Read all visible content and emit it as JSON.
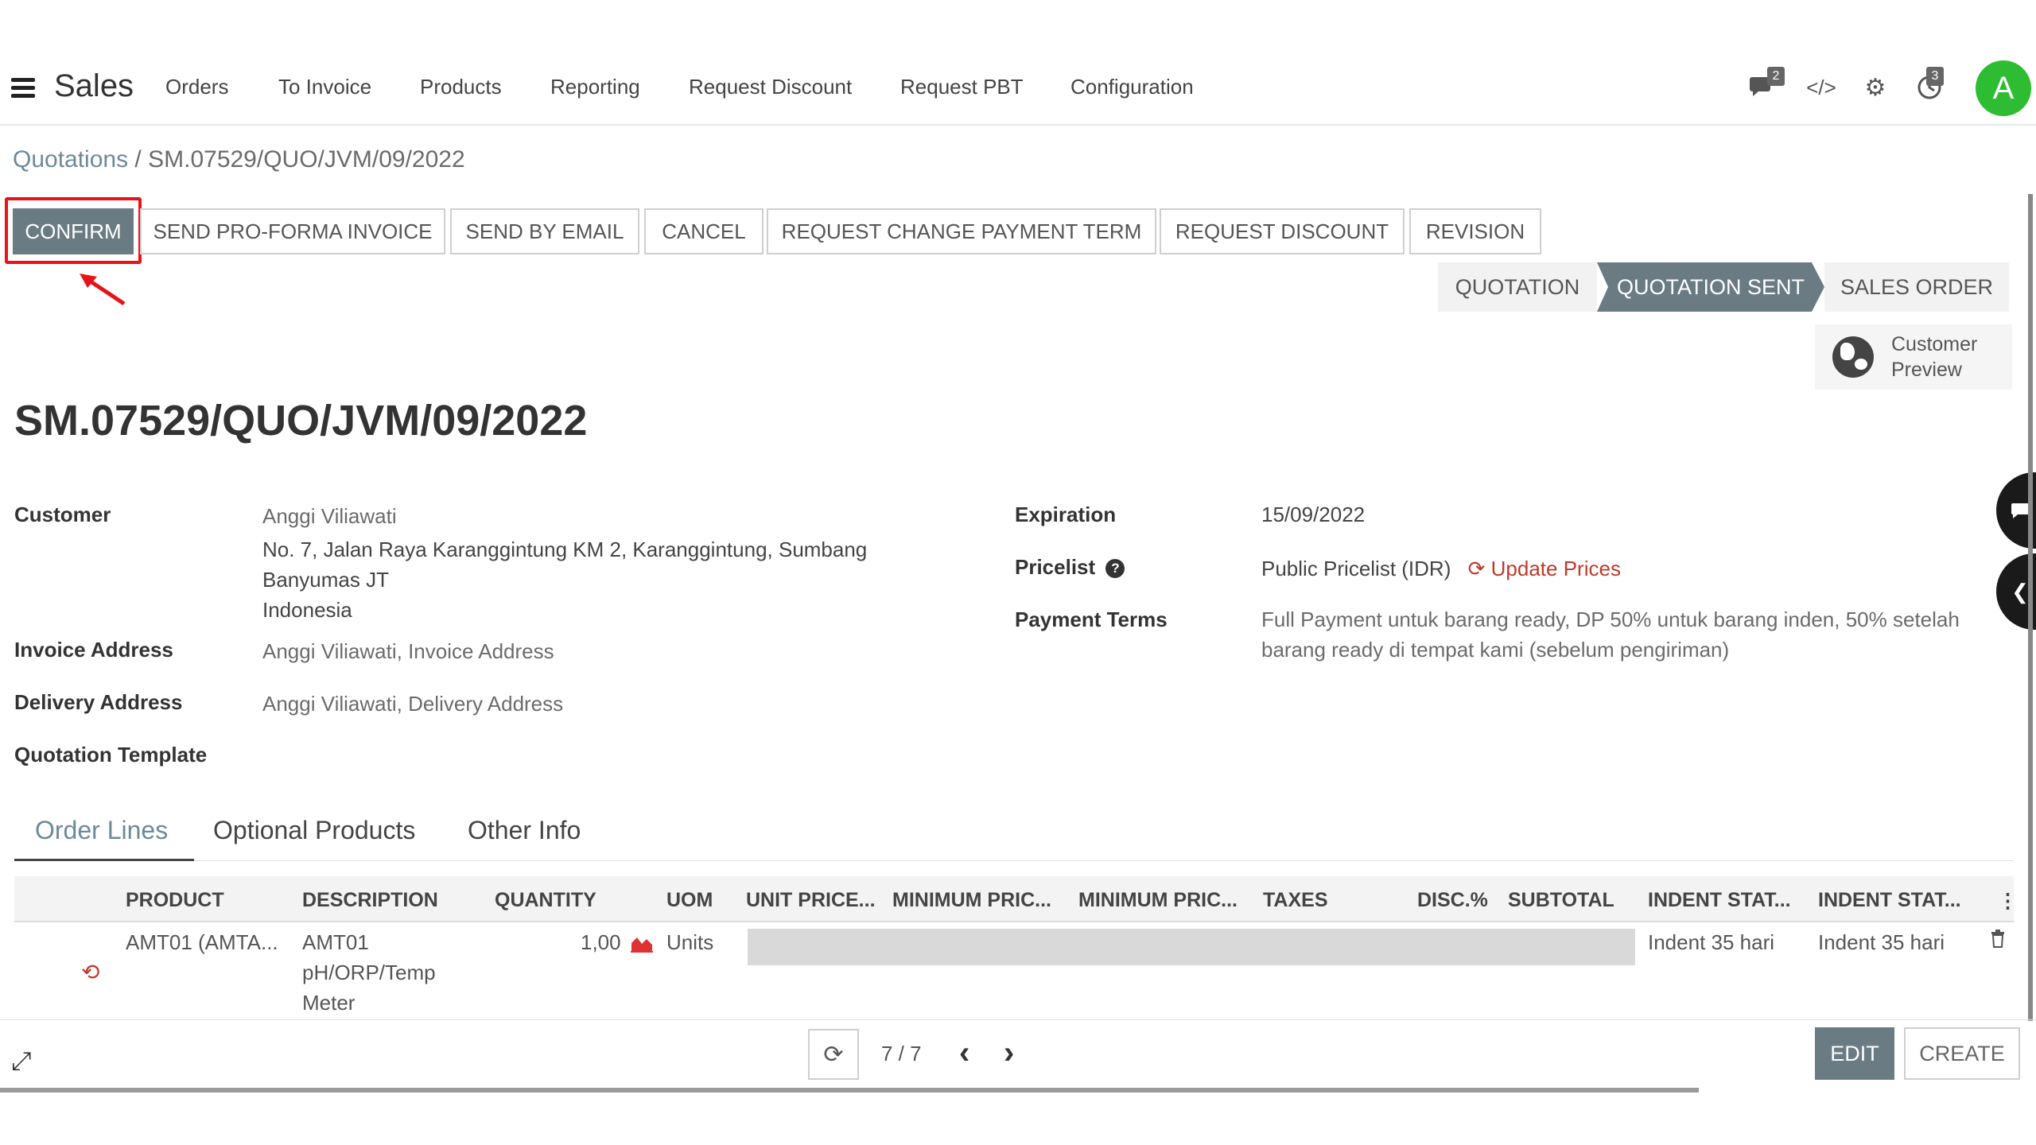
{
  "nav": {
    "app_title": "Sales",
    "menu": [
      "Orders",
      "To Invoice",
      "Products",
      "Reporting",
      "Request Discount",
      "Request PBT",
      "Configuration"
    ],
    "messages_badge": "2",
    "activity_badge": "3",
    "avatar_letter": "A"
  },
  "breadcrumb": {
    "parent": "Quotations",
    "separator": " / ",
    "current": "SM.07529/QUO/JVM/09/2022"
  },
  "actions": {
    "confirm": "CONFIRM",
    "send_proforma": "SEND PRO-FORMA INVOICE",
    "send_email": "SEND BY EMAIL",
    "cancel": "CANCEL",
    "request_change_payment": "REQUEST CHANGE PAYMENT TERM",
    "request_discount": "REQUEST DISCOUNT",
    "revision": "REVISION"
  },
  "status": {
    "stages": [
      "QUOTATION",
      "QUOTATION SENT",
      "SALES ORDER"
    ],
    "active": "QUOTATION SENT"
  },
  "customer_preview": {
    "line1": "Customer",
    "line2": "Preview"
  },
  "record": {
    "title": "SM.07529/QUO/JVM/09/2022"
  },
  "fields": {
    "customer_label": "Customer",
    "customer_name": "Anggi Viliawati",
    "customer_address1": "No. 7, Jalan Raya Karanggintung KM 2, Karanggintung, Sumbang",
    "customer_address2": "Banyumas JT",
    "customer_address3": "Indonesia",
    "invoice_label": "Invoice Address",
    "invoice_value": "Anggi Viliawati, Invoice Address",
    "delivery_label": "Delivery Address",
    "delivery_value": "Anggi Viliawati, Delivery Address",
    "template_label": "Quotation Template",
    "expiration_label": "Expiration",
    "expiration_value": "15/09/2022",
    "pricelist_label": "Pricelist",
    "pricelist_help": "?",
    "pricelist_value": "Public Pricelist (IDR)",
    "update_prices": "Update Prices",
    "payment_label": "Payment Terms",
    "payment_line1": "Full Payment untuk barang ready, DP 50% untuk barang inden, 50% setelah",
    "payment_line2": "barang ready di tempat kami (sebelum pengiriman)"
  },
  "tabs": [
    "Order Lines",
    "Optional Products",
    "Other Info"
  ],
  "table": {
    "headers": [
      "PRODUCT",
      "DESCRIPTION",
      "QUANTITY",
      "UOM",
      "UNIT PRICE...",
      "MINIMUM PRIC...",
      "MINIMUM PRIC...",
      "TAXES",
      "DISC.%",
      "SUBTOTAL",
      "INDENT STAT...",
      "INDENT STAT..."
    ],
    "row": {
      "product": "AMT01 (AMTA...",
      "desc1": "AMT01",
      "desc2": "pH/ORP/Temp",
      "desc3": "Meter",
      "quantity": "1,00",
      "uom": "Units",
      "indent1": "Indent 35 hari",
      "indent2": "Indent 35 hari"
    }
  },
  "footer": {
    "pager": "7 / 7",
    "edit": "EDIT",
    "create": "CREATE"
  },
  "colors": {
    "primary": "#6b7b84",
    "highlight": "#e8121b",
    "avatar": "#2ebd32",
    "link": "#c0392b"
  }
}
